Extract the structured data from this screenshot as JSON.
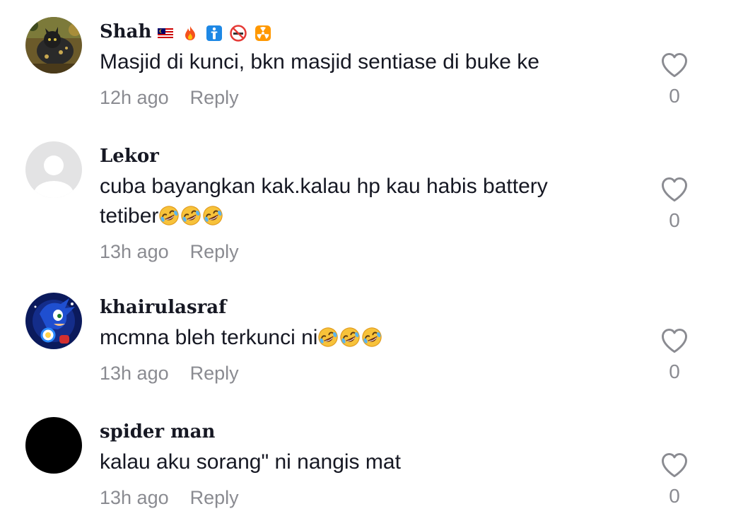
{
  "comments": [
    {
      "username": "Shah",
      "badges": [
        "malaysia-flag-icon",
        "fire-icon",
        "person-info-icon",
        "no-smoking-icon",
        "radioactive-icon"
      ],
      "text": "Masjid di kunci, bkn masjid sentiase di buke ke",
      "time": "12h ago",
      "reply": "Reply",
      "likes": "0",
      "avatar": "cat-photo-avatar"
    },
    {
      "username": "Lekor",
      "text_line1": "cuba bayangkan kak.kalau hp kau habis battery",
      "text_line2": "tetiber",
      "emojis": [
        "rofl-emoji",
        "rofl-emoji",
        "rofl-emoji"
      ],
      "time": "13h ago",
      "reply": "Reply",
      "likes": "0",
      "avatar": "default-avatar"
    },
    {
      "username": "khairulasraf",
      "text": "mcmna bleh terkunci ni",
      "emojis": [
        "rofl-emoji",
        "rofl-emoji",
        "rofl-emoji"
      ],
      "time": "13h ago",
      "reply": "Reply",
      "likes": "0",
      "avatar": "sonic-avatar"
    },
    {
      "username": "spider man",
      "text": "kalau aku sorang\" ni nangis mat",
      "time": "13h ago",
      "reply": "Reply",
      "likes": "0",
      "avatar": "black-avatar"
    }
  ],
  "colors": {
    "text": "#161823",
    "muted": "#8a8b91",
    "heart_stroke": "#8a8b91"
  }
}
